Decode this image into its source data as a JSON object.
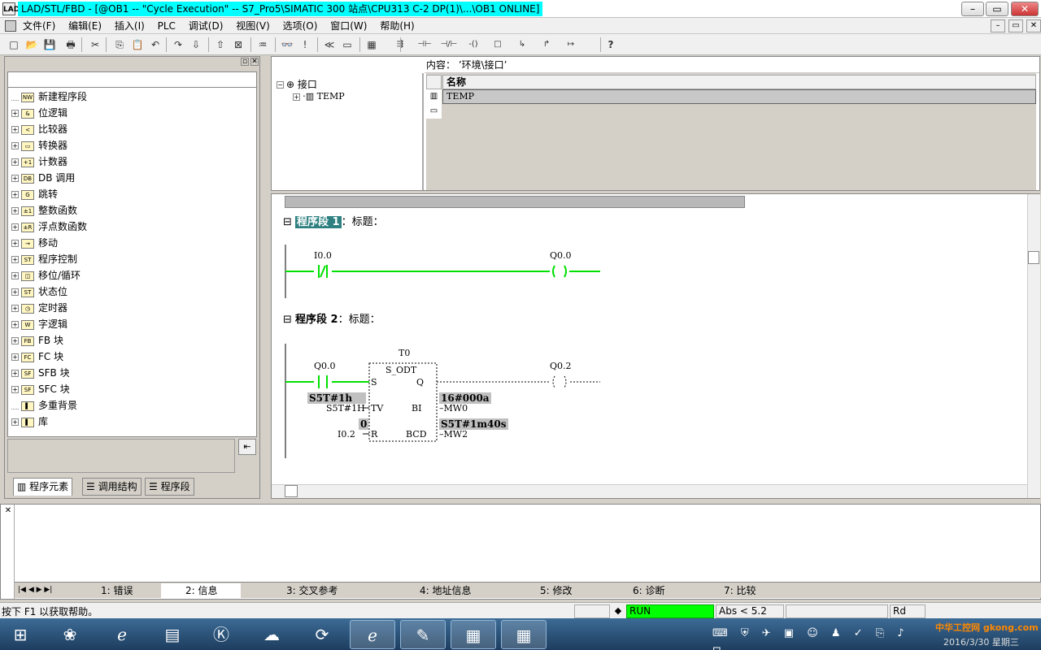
{
  "window": {
    "title": "LAD/STL/FBD  - [@OB1 -- \"Cycle Execution\" -- S7_Pro5\\SIMATIC 300 站点\\CPU313 C-2 DP(1)\\...\\OB1  ONLINE]",
    "app_icon": "LAD",
    "minimize": "–",
    "maximize": "▭",
    "close": "✕"
  },
  "menu": {
    "items": [
      "文件(F)",
      "编辑(E)",
      "插入(I)",
      "PLC",
      "调试(D)",
      "视图(V)",
      "选项(O)",
      "窗口(W)",
      "帮助(H)"
    ],
    "mdi_buttons": [
      "–",
      "▭",
      "✕"
    ]
  },
  "toolbar": {
    "icons": [
      "new-icon",
      "open-icon",
      "save-icon",
      "print-icon",
      "cut-icon",
      "copy-icon",
      "paste-icon",
      "undo-icon",
      "redo-icon",
      "download-icon",
      "upload-icon",
      "online-icon",
      "monitor-icon",
      "glasses-icon",
      "nav-icon",
      "nav2-icon",
      "view-icon",
      "overview-icon",
      "box-icon",
      "contact-no-icon",
      "contact-nc-icon",
      "coil-icon",
      "box2-icon",
      "branch-open-icon",
      "branch-close-icon",
      "connection-icon",
      "help-icon"
    ],
    "glyphs": [
      "□",
      "📂",
      "💾",
      "🖶",
      "✂",
      "⎘",
      "📋",
      "↶",
      "↷",
      "⇩",
      "⇧",
      "⊠",
      "♒",
      "👓",
      "!",
      "≪",
      "▭",
      "▦",
      "⇶",
      "⊣⊢",
      "⊣/⊢",
      "-()",
      "□",
      "↳",
      "↱",
      "↦",
      "?"
    ]
  },
  "left_panel": {
    "tree": [
      {
        "label": "新建程序段",
        "icon": "NW",
        "expandable": false
      },
      {
        "label": "位逻辑",
        "icon": "&",
        "expandable": true
      },
      {
        "label": "比较器",
        "icon": "<",
        "expandable": true
      },
      {
        "label": "转换器",
        "icon": "▭",
        "expandable": true
      },
      {
        "label": "计数器",
        "icon": "+1",
        "expandable": true
      },
      {
        "label": "DB 调用",
        "icon": "DB",
        "expandable": true
      },
      {
        "label": "跳转",
        "icon": "G",
        "expandable": true
      },
      {
        "label": "整数函数",
        "icon": "±1",
        "expandable": true
      },
      {
        "label": "浮点数函数",
        "icon": "±R",
        "expandable": true
      },
      {
        "label": "移动",
        "icon": "→",
        "expandable": true
      },
      {
        "label": "程序控制",
        "icon": "ST",
        "expandable": true
      },
      {
        "label": "移位/循环",
        "icon": "◫",
        "expandable": true
      },
      {
        "label": "状态位",
        "icon": "ST",
        "expandable": true
      },
      {
        "label": "定时器",
        "icon": "◷",
        "expandable": true
      },
      {
        "label": "字逻辑",
        "icon": "W",
        "expandable": true
      },
      {
        "label": "FB 块",
        "icon": "FB",
        "expandable": true
      },
      {
        "label": "FC 块",
        "icon": "FC",
        "expandable": true
      },
      {
        "label": "SFB 块",
        "icon": "SF",
        "expandable": true
      },
      {
        "label": "SFC 块",
        "icon": "SF",
        "expandable": true
      },
      {
        "label": "多重背景",
        "icon": "▌",
        "expandable": false
      },
      {
        "label": "库",
        "icon": "▌",
        "expandable": true
      }
    ],
    "tabs": [
      "程序元素",
      "调用结构",
      "程序段"
    ],
    "box_button": "⇤"
  },
  "interface": {
    "content_label": "内容： ’环境\\接口’",
    "tree_root": "接口",
    "tree_child": "TEMP",
    "column_name": "名称",
    "row": "TEMP"
  },
  "editor": {
    "network1": {
      "label": "程序段 1",
      "suffix": "：标题：",
      "contact": "I0.0",
      "coil": "Q0.0"
    },
    "network2": {
      "label": "程序段 2",
      "suffix": "：标题：",
      "contact": "Q0.0",
      "timer": "T0",
      "box": "S_ODT",
      "pin_s": "S",
      "pin_q": "Q",
      "pin_tv": "TV",
      "pin_bi": "BI",
      "pin_r": "R",
      "pin_bcd": "BCD",
      "tv_value": "S5T#1h",
      "tv_operand": "S5T#1H",
      "r_value": "0",
      "r_operand": "I0.2",
      "bi_value": "16#000a",
      "bi_operand": "MW0",
      "bcd_value": "S5T#1m40s",
      "bcd_operand": "MW2",
      "coil": "Q0.2"
    }
  },
  "output": {
    "tabs": [
      "1: 错误",
      "2: 信息",
      "3: 交叉参考",
      "4: 地址信息",
      "5: 修改",
      "6: 诊断",
      "7: 比较"
    ]
  },
  "status": {
    "help": "按下 F1 以获取帮助。",
    "run": "RUN",
    "run_color": "#00ff00",
    "abs": "Abs < 5.2",
    "rd": "Rd"
  },
  "taskbar": {
    "date": "2016/3/30 星期三",
    "watermark": "中华工控网 gkong.com",
    "apps": [
      "start-orb",
      "paint-icon",
      "ie-icon",
      "explorer-icon",
      "k-icon",
      "cloud-icon",
      "refresh-icon",
      "ie2-icon",
      "simatic-icon",
      "lad-icon",
      "fbd-icon"
    ]
  },
  "colors": {
    "ladder_green": "#00e000",
    "accent_cyan": "#00ffff",
    "network_hl": "#2e8080"
  }
}
